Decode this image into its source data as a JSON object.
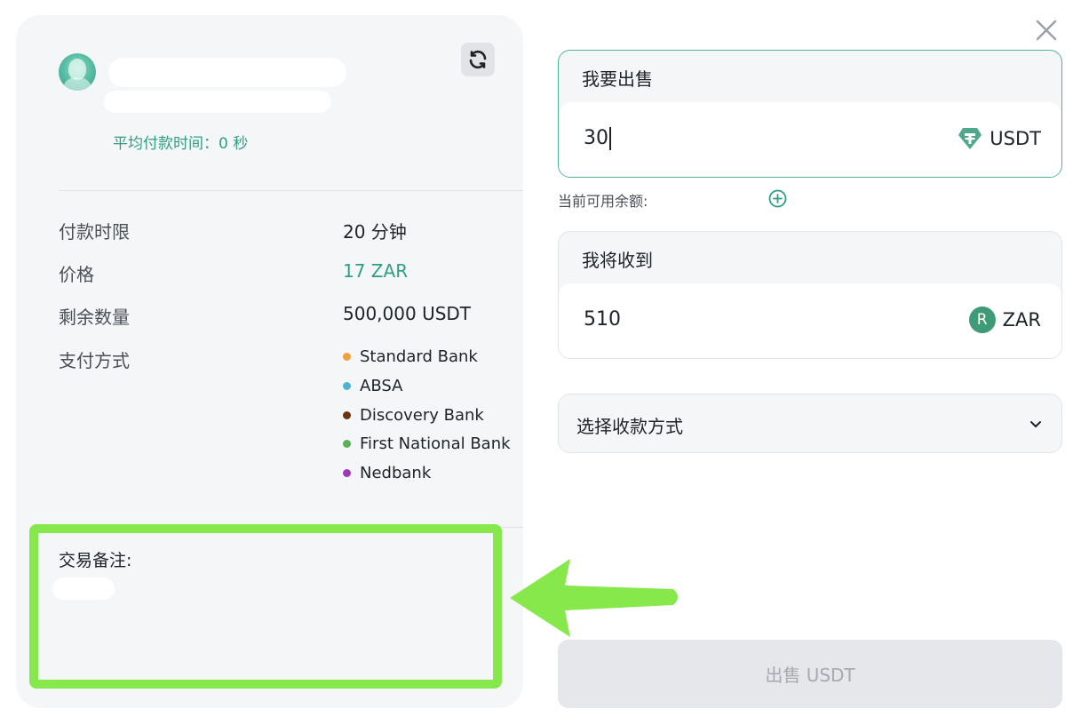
{
  "left_panel": {
    "avg_time": "平均付款时间：0 秒",
    "info_rows": [
      {
        "label": "付款时限",
        "value": "20 分钟"
      },
      {
        "label": "价格",
        "value": "17 ZAR"
      },
      {
        "label": "剩余数量",
        "value": "500,000 USDT"
      },
      {
        "label": "支付方式",
        "value": ""
      }
    ],
    "payment_methods": [
      {
        "name": "Standard Bank",
        "color": "#f0a03c"
      },
      {
        "name": "ABSA",
        "color": "#4eb3d3"
      },
      {
        "name": "Discovery Bank",
        "color": "#6b3410"
      },
      {
        "name": "First National Bank",
        "color": "#5bb05a"
      },
      {
        "name": "Nedbank",
        "color": "#9c3bb5"
      }
    ],
    "remark_label": "交易备注:",
    "price_color": "#2e9e84"
  },
  "sell": {
    "title": "我要出售",
    "amount": "30",
    "currency": "USDT",
    "currency_icon": "tether-icon",
    "balance_label": "当前可用余额:"
  },
  "receive": {
    "title": "我将收到",
    "amount": "510",
    "currency": "ZAR",
    "currency_symbol": "R"
  },
  "payment_select": {
    "label": "选择收款方式"
  },
  "submit": {
    "label": "出售 USDT"
  },
  "colors": {
    "accent": "#2e9e84",
    "highlight": "#86e84a"
  }
}
